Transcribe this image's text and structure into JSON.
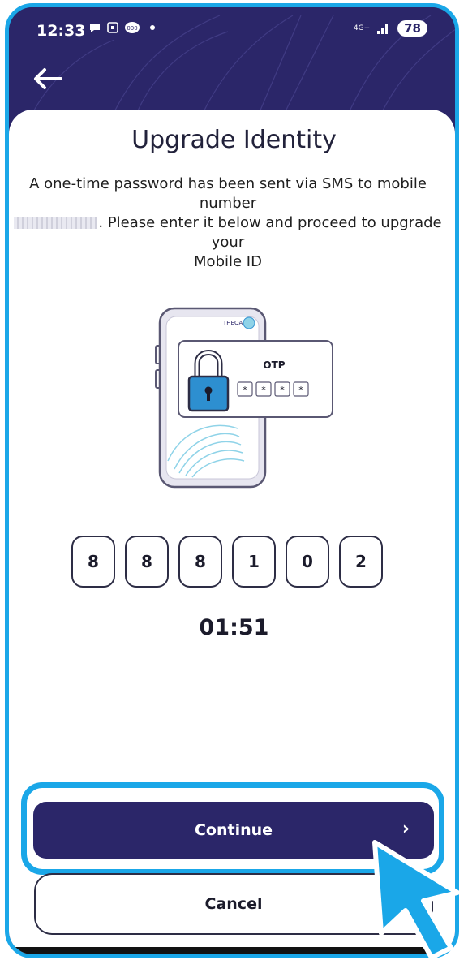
{
  "status_bar": {
    "time": "12:33",
    "network": "4G+",
    "battery": "78"
  },
  "page": {
    "title": "Upgrade Identity",
    "description_line1": "A one-time password has been sent via SMS to mobile number",
    "description_line2": ". Please enter it below and proceed to upgrade your",
    "description_line3": "Mobile ID"
  },
  "illustration": {
    "otp_label": "OTP",
    "brand_text": "THEQA",
    "mask_char": "*"
  },
  "otp": {
    "digits": [
      "8",
      "8",
      "8",
      "1",
      "0",
      "2"
    ]
  },
  "timer": "01:51",
  "buttons": {
    "continue_label": "Continue",
    "continue_chevron": "›",
    "cancel_label": "Cancel"
  },
  "colors": {
    "brand_dark": "#2b2669",
    "highlight": "#1aa7e8",
    "lock_blue": "#2d8fd0"
  }
}
